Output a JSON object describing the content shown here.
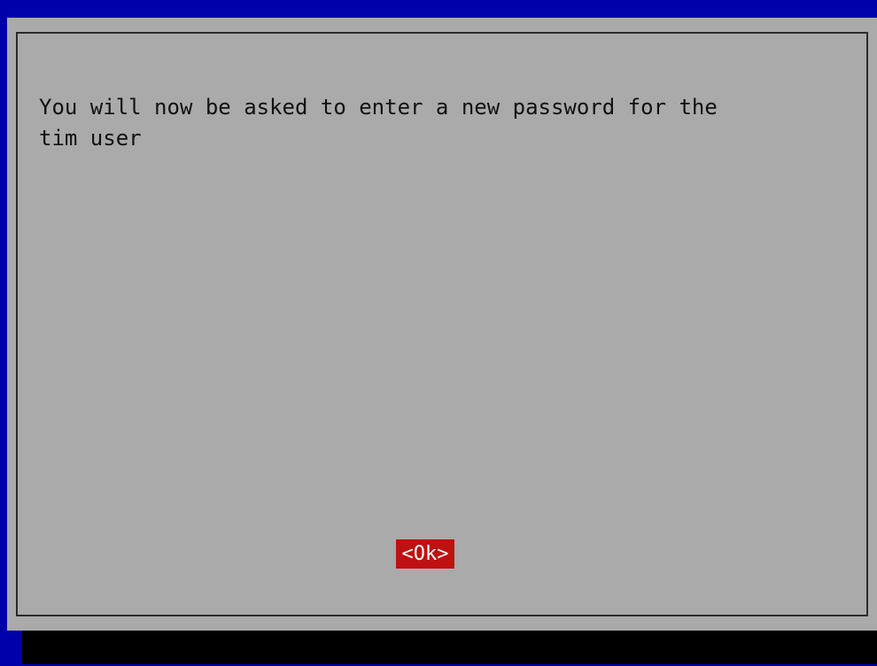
{
  "dialog": {
    "message": "You will now be asked to enter a new password for the\ntim user",
    "ok_label": "<Ok>"
  },
  "colors": {
    "background_blue": "#0000aa",
    "dialog_gray": "#aaaaaa",
    "button_red": "#bf1111",
    "bottom_bar_black": "#000000"
  }
}
